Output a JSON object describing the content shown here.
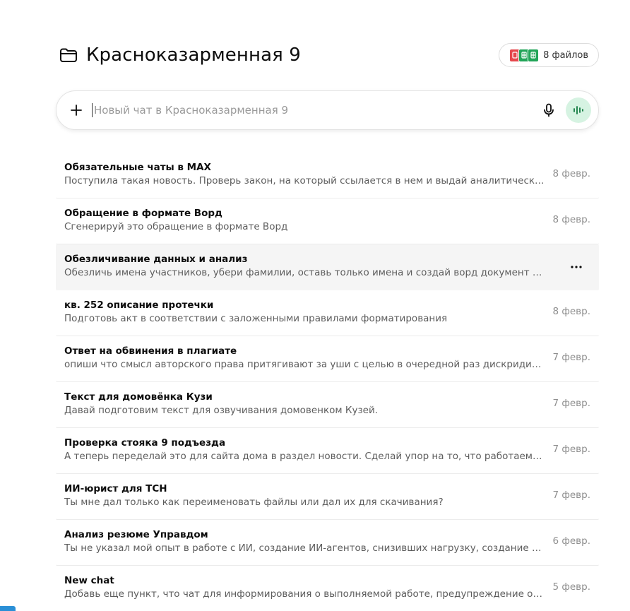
{
  "project": {
    "title": "Краснoказарменная 9",
    "files_label": "8 файлов",
    "file_chips": [
      {
        "kind": "pdf",
        "color": "#e5484d"
      },
      {
        "kind": "sheet",
        "color": "#22a559"
      },
      {
        "kind": "sheet",
        "color": "#22a559"
      }
    ]
  },
  "composer": {
    "placeholder": "Новый чат в Красноказарменная 9",
    "value": "",
    "accent": "#d6f3e2"
  },
  "chats": [
    {
      "title": "Обязательные чаты в MAX",
      "snippet": "Поступила такая новость. Проверь закон, на который ссылается в нем и выдай аналитическую справку",
      "date": "8 февр.",
      "hovered": false
    },
    {
      "title": "Обращение в формате Ворд",
      "snippet": "Сгенерируй это обращение в формате Ворд",
      "date": "8 февр.",
      "hovered": false
    },
    {
      "title": "Обезличивание данных и анализ",
      "snippet": "Обезличь имена участников, убери фамилии, оставь только имена и создай ворд документ для скачивания",
      "date": "8 февр.",
      "hovered": true
    },
    {
      "title": "кв. 252 описание протечки",
      "snippet": "Подготовь акт в соответствии с заложенными правилами форматирования",
      "date": "8 февр.",
      "hovered": false
    },
    {
      "title": "Ответ на обвинения в плагиате",
      "snippet": "опиши что смысл авторского права притягивают за уши с целью в очередной раз дискридитировать меня",
      "date": "7 февр.",
      "hovered": false
    },
    {
      "title": "Текст для домовёнка Кузи",
      "snippet": "Давай подготовим текст для озвучивания домовенком Кузей.",
      "date": "7 февр.",
      "hovered": false
    },
    {
      "title": "Проверка стояка 9 подъезда",
      "snippet": "А теперь переделай это для сайта дома в раздел новости. Сделай упор на то, что работаем без выходных",
      "date": "7 февр.",
      "hovered": false
    },
    {
      "title": "ИИ-юрист для ТСН",
      "snippet": "Ты мне дал только как переименовать файлы или дал их для скачивания?",
      "date": "7 февр.",
      "hovered": false
    },
    {
      "title": "Анализ резюме Управдом",
      "snippet": "Ты не указал мой опыт в работе с ИИ, создание ИИ-агентов, снизивших нагрузку, создание ИИ-агентов для",
      "date": "6 февр.",
      "hovered": false
    },
    {
      "title": "New chat",
      "snippet": "Добавь еще пункт, что чат для информирования о выполняемой работе, предупреждение об аварийных",
      "date": "5 февр.",
      "hovered": false
    }
  ]
}
